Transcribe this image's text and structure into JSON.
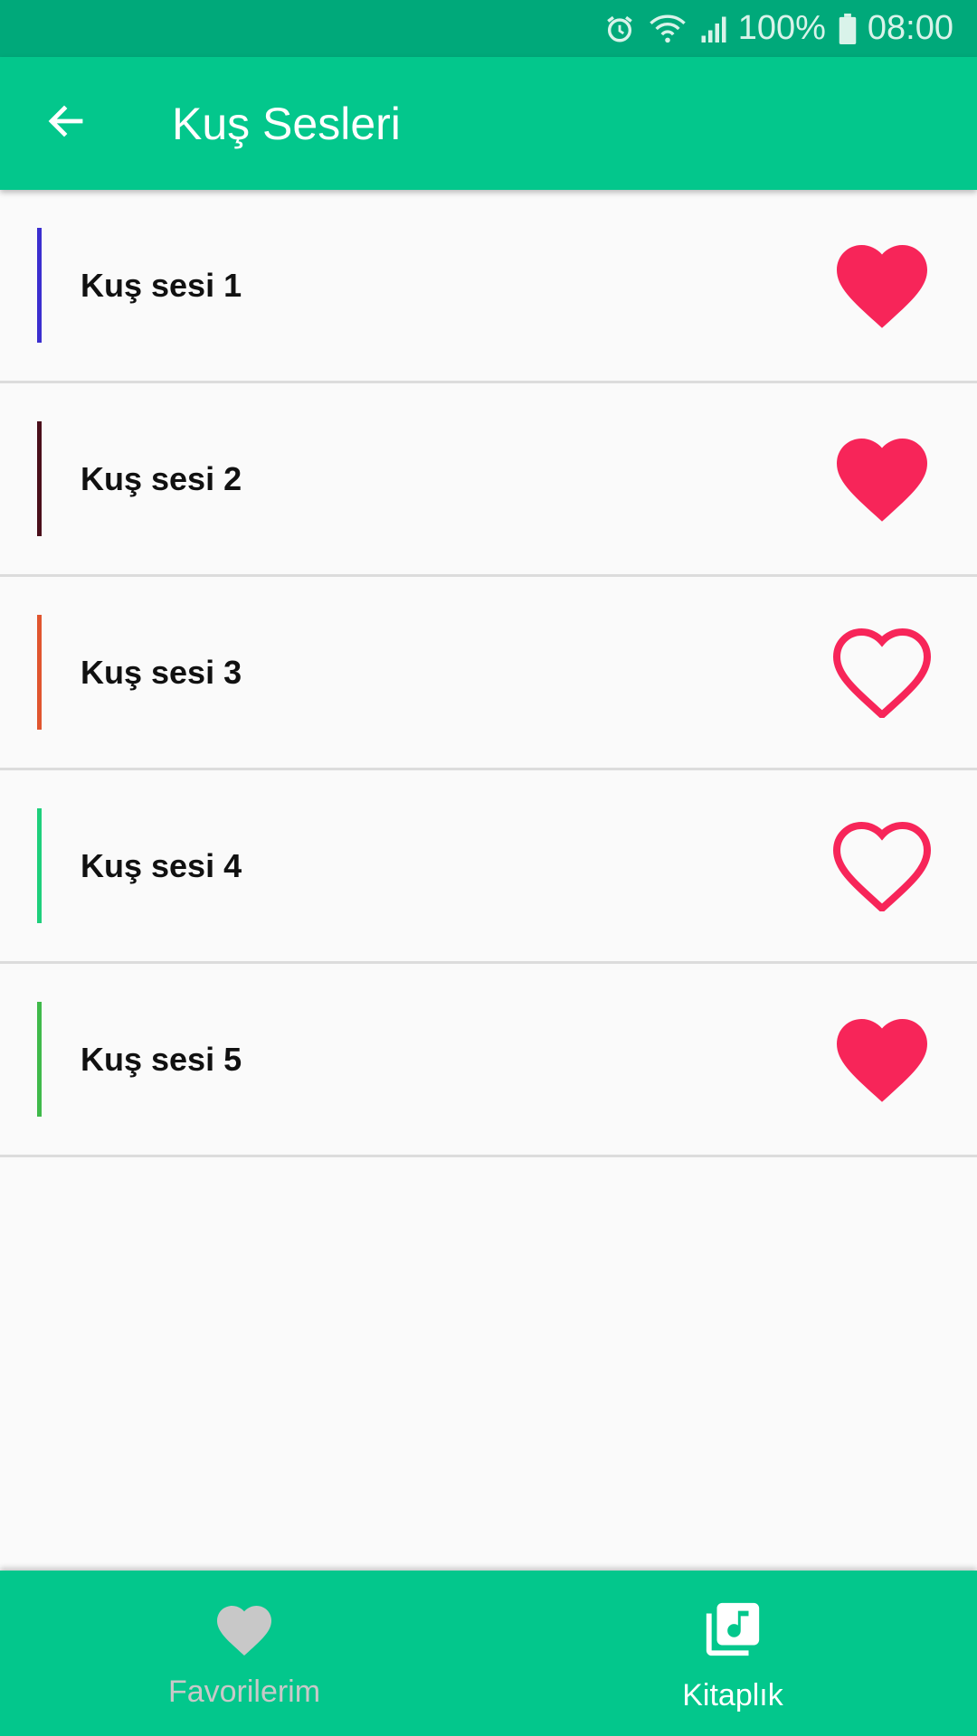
{
  "status_bar": {
    "battery": "100%",
    "time": "08:00"
  },
  "app_bar": {
    "title": "Kuş Sesleri"
  },
  "list": {
    "items": [
      {
        "label": "Kuş sesi 1",
        "accent_color": "#3b2fcf",
        "favorite": true
      },
      {
        "label": "Kuş sesi 2",
        "accent_color": "#4a0f1b",
        "favorite": true
      },
      {
        "label": "Kuş sesi 3",
        "accent_color": "#e0552f",
        "favorite": false
      },
      {
        "label": "Kuş sesi 4",
        "accent_color": "#1ecf7c",
        "favorite": false
      },
      {
        "label": "Kuş sesi 5",
        "accent_color": "#3fb94a",
        "favorite": true
      }
    ]
  },
  "bottom_nav": {
    "favorites_label": "Favorilerim",
    "library_label": "Kitaplık"
  },
  "colors": {
    "primary": "#03c78c",
    "status_bar": "#00a97a",
    "heart": "#f72559"
  }
}
